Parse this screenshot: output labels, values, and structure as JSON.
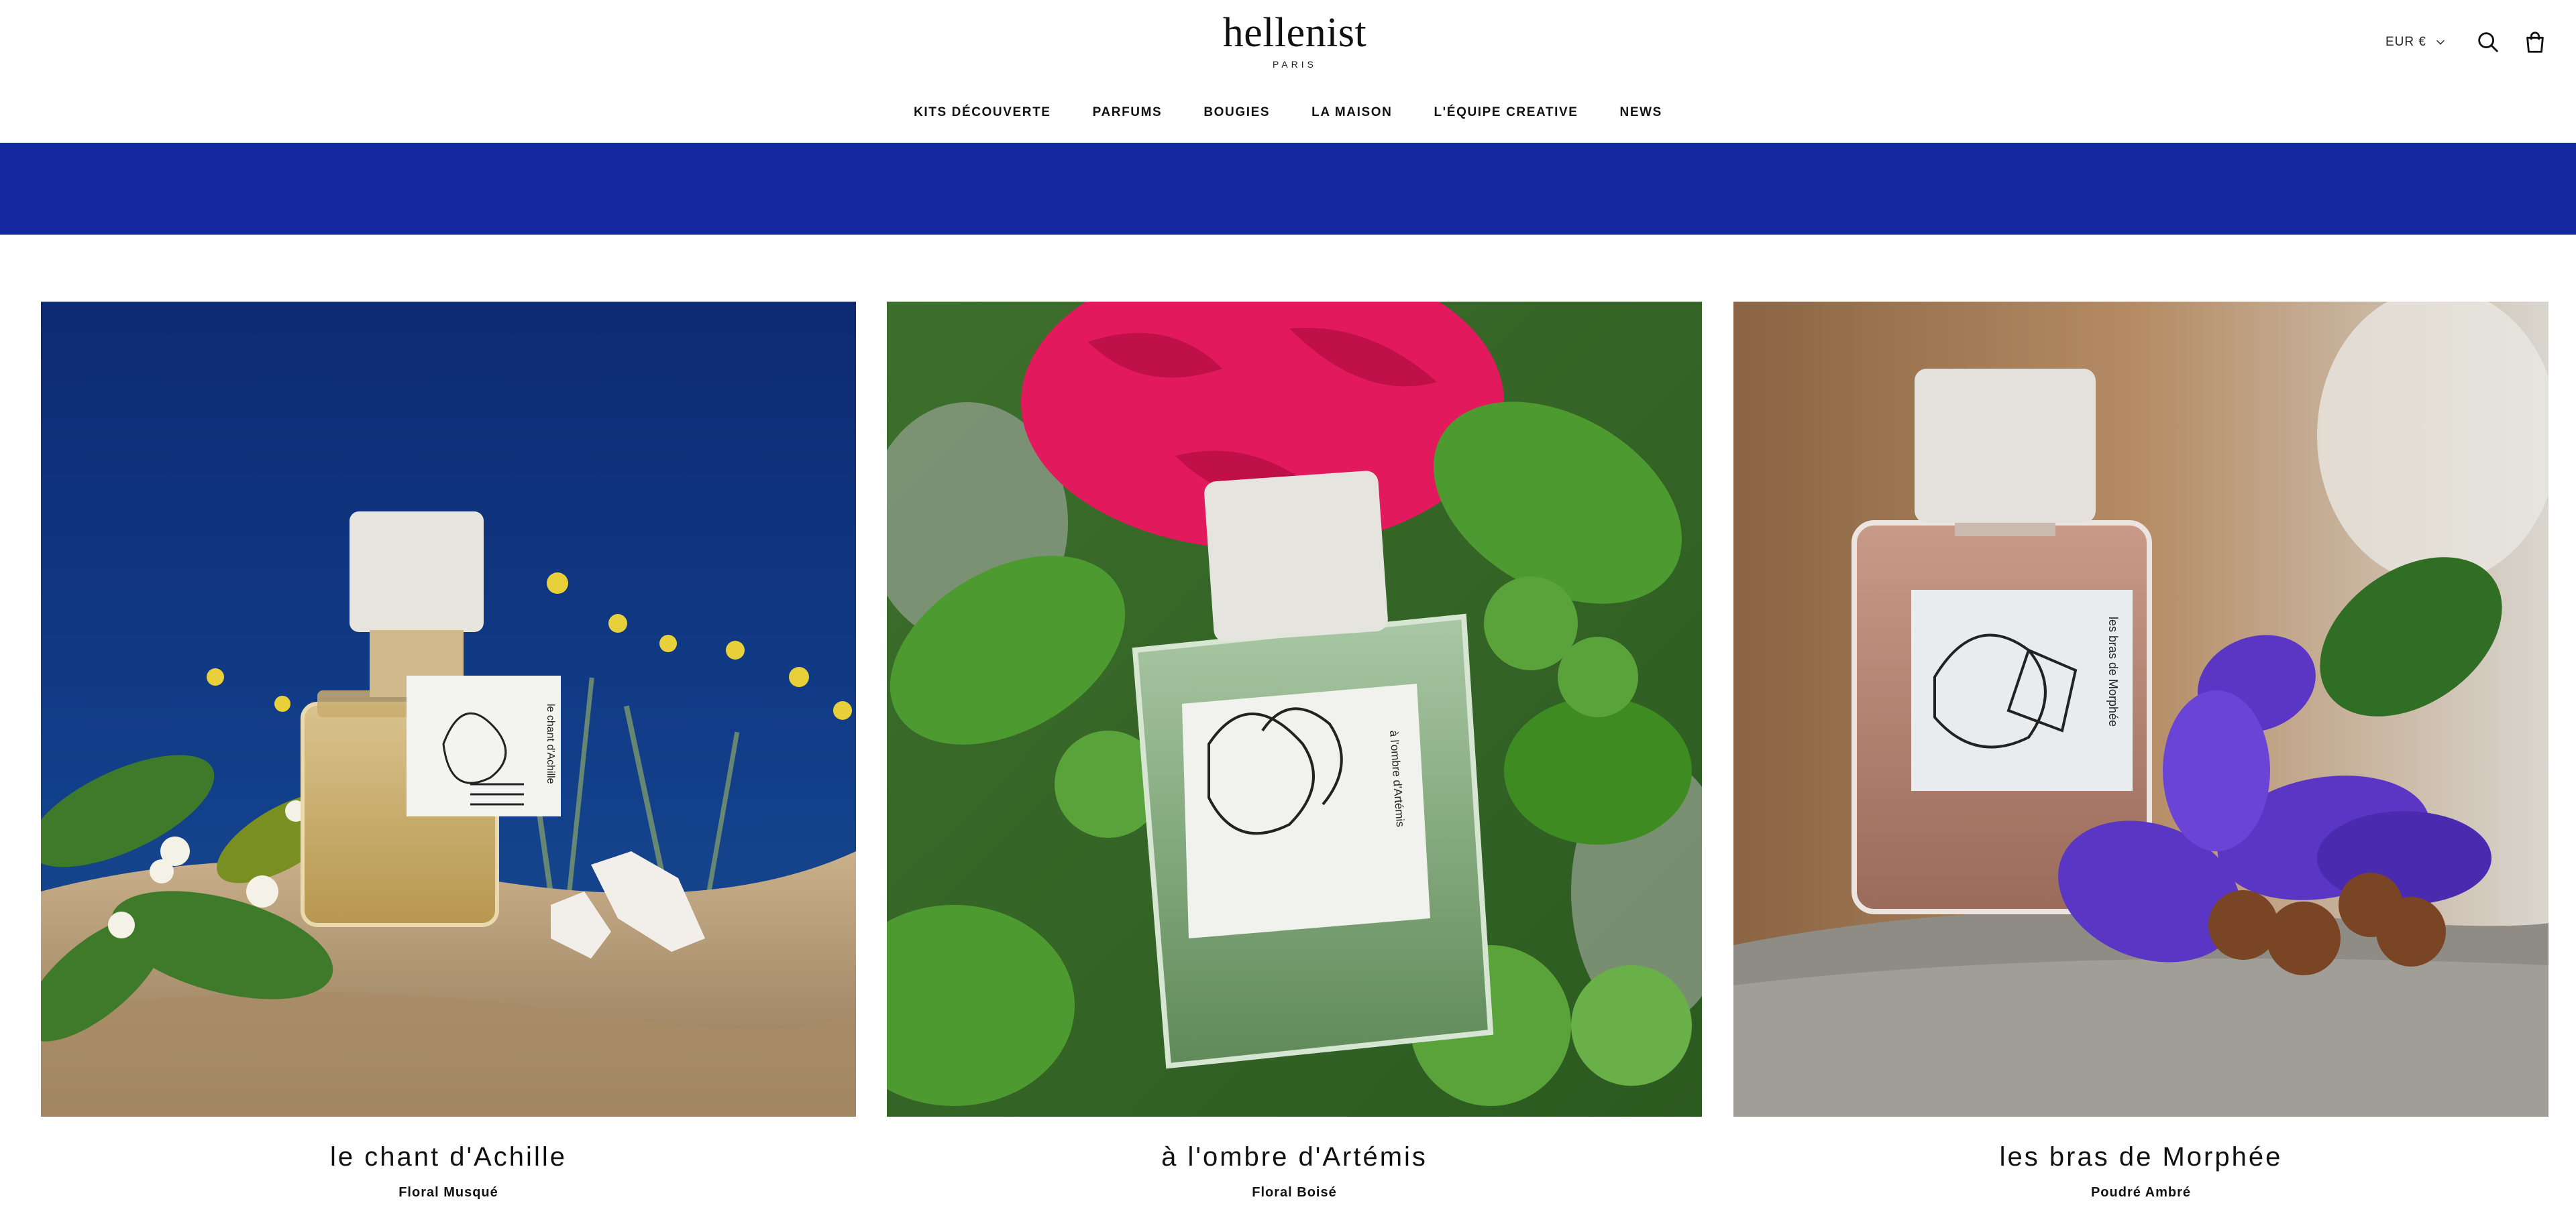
{
  "header": {
    "logo": "hellenist",
    "logo_sub": "PARIS",
    "currency": "EUR €",
    "icons": {
      "search": "search-icon",
      "cart": "bag-icon",
      "currency_caret": "chevron-down-icon"
    }
  },
  "nav": {
    "items": [
      {
        "label": "KITS DÉCOUVERTE"
      },
      {
        "label": "PARFUMS"
      },
      {
        "label": "BOUGIES"
      },
      {
        "label": "LA MAISON"
      },
      {
        "label": "L'ÉQUIPE CREATIVE"
      },
      {
        "label": "NEWS"
      }
    ]
  },
  "banner": {
    "color": "#1428a0"
  },
  "products": [
    {
      "name": "le chant d'Achille",
      "family": "Floral Musqué",
      "label_text": "le chant d'Achille"
    },
    {
      "name": "à l'ombre d'Artémis",
      "family": "Floral Boisé",
      "label_text": "à l'ombre d'Artémis"
    },
    {
      "name": "les bras de Morphée",
      "family": "Poudré Ambré",
      "label_text": "les bras de Morphée"
    }
  ]
}
